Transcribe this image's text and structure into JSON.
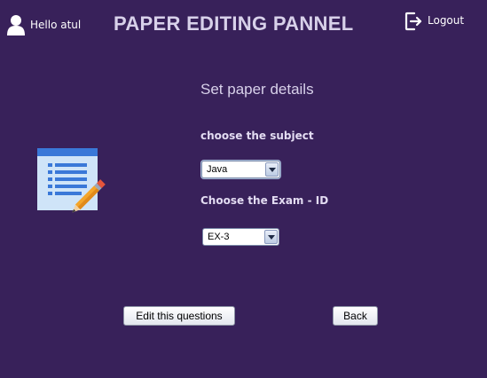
{
  "header": {
    "greeting": "Hello atul",
    "title": "PAPER EDITING PANNEL",
    "logout_label": "Logout",
    "user_icon": "user-icon",
    "logout_icon": "logout-icon"
  },
  "form": {
    "section_title": "Set paper details",
    "subject_label": "choose the subject",
    "subject_value": "Java",
    "exam_label": "Choose the Exam - ID",
    "exam_value": "EX-3"
  },
  "buttons": {
    "edit_label": "Edit this questions",
    "back_label": "Back"
  },
  "colors": {
    "background": "#38215A",
    "title_text": "#D8D1EA",
    "doc_blue": "#3A78D8",
    "doc_page": "#CFE4F8",
    "pencil": "#F4A52A"
  },
  "illustration": "document-with-pencil-icon"
}
